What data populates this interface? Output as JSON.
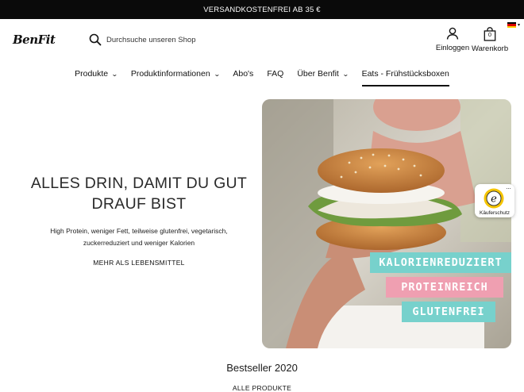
{
  "announcement": "VERSANDKOSTENFREI AB 35 €",
  "header": {
    "logo": "BenFit",
    "search_placeholder": "Durchsuche unseren Shop",
    "account_label": "Einloggen",
    "cart_label": "Warenkorb",
    "cart_count": "0",
    "language_flag": "de-flag"
  },
  "nav": {
    "items": [
      {
        "label": "Produkte",
        "dropdown": true
      },
      {
        "label": "Produktinformationen",
        "dropdown": true
      },
      {
        "label": "Abo's",
        "dropdown": false
      },
      {
        "label": "FAQ",
        "dropdown": false
      },
      {
        "label": "Über Benfit",
        "dropdown": true
      },
      {
        "label": "Eats - Frühstücksboxen",
        "dropdown": false,
        "active": true
      }
    ]
  },
  "hero": {
    "title_line1": "ALLES DRIN, DAMIT DU GUT",
    "title_line2": "DRAUF BIST",
    "sub_line1": "High Protein, weniger Fett, teilweise glutenfrei, vegetarisch,",
    "sub_line2": "zuckerreduziert und weniger Kalorien",
    "link": "MEHR ALS LEBENSMITTEL",
    "badges": [
      "KALORIENREDUZIERT",
      "PROTEINREICH",
      "GLUTENFREI"
    ]
  },
  "trust_badge": {
    "label": "Käuferschutz",
    "seal_letter": "e"
  },
  "bestseller": {
    "title": "Bestseller 2020",
    "link": "ALLE PRODUKTE"
  },
  "colors": {
    "accent_teal": "#77d1cc",
    "accent_pink": "#ef9fb1",
    "announcement_bg": "#0a0a0a"
  }
}
